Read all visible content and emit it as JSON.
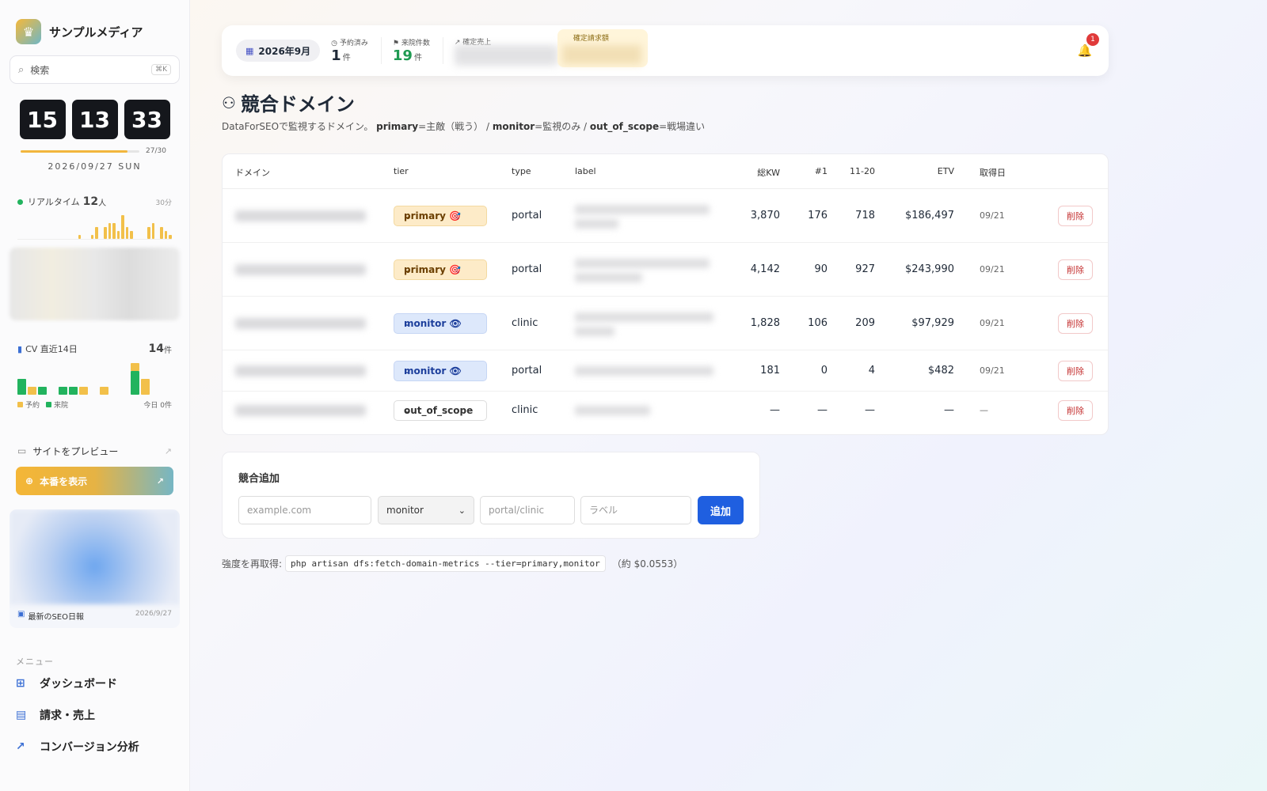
{
  "brand": {
    "name": "サンプルメディア",
    "logo_icon": "crown-icon"
  },
  "search": {
    "placeholder": "検索",
    "shortcut": "⌘K"
  },
  "clock": {
    "h": "15",
    "m": "13",
    "s": "33"
  },
  "day_progress": {
    "label": "27/30",
    "fraction": 0.9
  },
  "date": "2026/09/27 SUN",
  "realtime": {
    "label": "リアルタイム",
    "count": "12",
    "unit": "人",
    "span": "30分",
    "bars": [
      0,
      0,
      0,
      0,
      0,
      0,
      0,
      0,
      0,
      0,
      0,
      0,
      0,
      0,
      1,
      0,
      0,
      1,
      3,
      0,
      3,
      4,
      4,
      2,
      6,
      3,
      2,
      0,
      0,
      0,
      3,
      4,
      0,
      3,
      2,
      1
    ]
  },
  "cv": {
    "label": "CV 直近14日",
    "total": "14",
    "unit": "件",
    "legend_reserve": "予約",
    "legend_visit": "来院",
    "today_label": "今日 0件",
    "color_reserve": "#f2c04a",
    "color_visit": "#22b35e",
    "days": [
      {
        "visit": 2,
        "reserve": 0
      },
      {
        "visit": 0,
        "reserve": 1
      },
      {
        "visit": 1,
        "reserve": 0
      },
      {
        "visit": 0,
        "reserve": 0
      },
      {
        "visit": 1,
        "reserve": 0
      },
      {
        "visit": 1,
        "reserve": 0
      },
      {
        "visit": 0,
        "reserve": 1
      },
      {
        "visit": 0,
        "reserve": 0
      },
      {
        "visit": 0,
        "reserve": 1
      },
      {
        "visit": 0,
        "reserve": 0
      },
      {
        "visit": 0,
        "reserve": 0
      },
      {
        "visit": 3,
        "reserve": 1
      },
      {
        "visit": 0,
        "reserve": 2
      },
      {
        "visit": 0,
        "reserve": 0
      }
    ]
  },
  "nav": {
    "preview": "サイトをプレビュー",
    "production": "本番を表示",
    "seo_report": "最新のSEO日報",
    "seo_date": "2026/9/27",
    "menu_heading": "メニュー",
    "menu_items": [
      {
        "label": "ダッシュボード",
        "icon": "grid-icon"
      },
      {
        "label": "請求・売上",
        "icon": "invoice-icon"
      },
      {
        "label": "コンバージョン分析",
        "icon": "trend-icon"
      }
    ]
  },
  "topbar": {
    "month": "2026年9月",
    "reserved_label": "予約済み",
    "reserved_value": "1",
    "reserved_unit": "件",
    "visits_label": "来院件数",
    "visits_value": "19",
    "visits_unit": "件",
    "sales_label": "確定売上",
    "invoice_label": "確定請求額",
    "notifications": "1"
  },
  "page": {
    "title": "競合ドメイン",
    "subtitle_prefix": "DataForSEOで監視するドメイン。",
    "primary_key": "primary",
    "primary_desc": "=主敵（戦う） / ",
    "monitor_key": "monitor",
    "monitor_desc": "=監視のみ / ",
    "out_key": "out_of_scope",
    "out_desc": "=戦場違い"
  },
  "table": {
    "headers": {
      "domain": "ドメイン",
      "tier": "tier",
      "type": "type",
      "label": "label",
      "kw": "総KW",
      "top1": "#1",
      "r1120": "11-20",
      "etv": "ETV",
      "date": "取得日"
    },
    "delete_label": "削除",
    "rows": [
      {
        "tier": "primary 🎯",
        "tier_class": "primary",
        "type": "portal",
        "kw": "3,870",
        "top1": "176",
        "r1120": "718",
        "etv": "$186,497",
        "date": "09/21"
      },
      {
        "tier": "primary 🎯",
        "tier_class": "primary",
        "type": "portal",
        "kw": "4,142",
        "top1": "90",
        "r1120": "927",
        "etv": "$243,990",
        "date": "09/21"
      },
      {
        "tier": "monitor 👁",
        "tier_class": "monitor",
        "type": "clinic",
        "kw": "1,828",
        "top1": "106",
        "r1120": "209",
        "etv": "$97,929",
        "date": "09/21"
      },
      {
        "tier": "monitor 👁",
        "tier_class": "monitor",
        "type": "portal",
        "kw": "181",
        "top1": "0",
        "r1120": "4",
        "etv": "$482",
        "date": "09/21"
      },
      {
        "tier": "out_of_scope",
        "tier_class": "out",
        "type": "clinic",
        "kw": "—",
        "top1": "—",
        "r1120": "—",
        "etv": "—",
        "date": "—"
      }
    ]
  },
  "add_form": {
    "title": "競合追加",
    "domain_placeholder": "example.com",
    "tier_value": "monitor",
    "type_placeholder": "portal/clinic",
    "label_placeholder": "ラベル",
    "submit": "追加"
  },
  "hint": {
    "prefix": "強度を再取得:",
    "command": "php artisan dfs:fetch-domain-metrics --tier=primary,monitor",
    "cost": "（約 $0.0553）"
  }
}
